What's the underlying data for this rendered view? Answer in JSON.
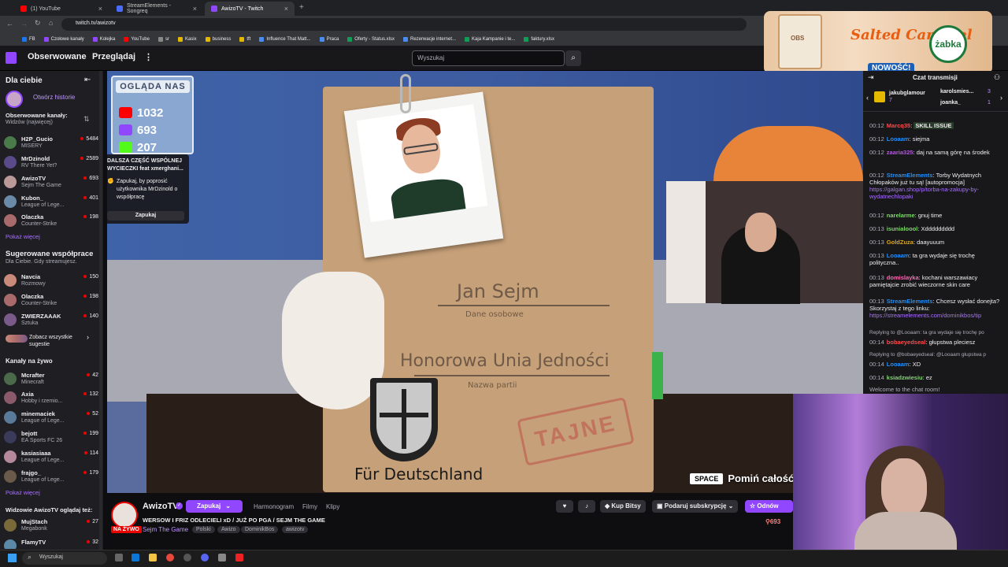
{
  "browser": {
    "tabs": [
      {
        "label": "(1) YouTube",
        "color": "#ff0000"
      },
      {
        "label": "StreamElements - Songreq",
        "color": "#4b6bfb"
      },
      {
        "label": "AwizoTV - Twitch",
        "color": "#9147ff"
      }
    ],
    "url": "twitch.tv/awizotv",
    "bookmarks": [
      "FB",
      "Czołowe kanały",
      "Kolejka",
      "YouTube",
      "sr",
      "Kasix",
      "business",
      "tft",
      "Influence That Matt...",
      "Praca",
      "Oferty - Status.xlsx",
      "Rezerwacje internet...",
      "Kaja Kampanie i te...",
      "faktury.xlsx"
    ]
  },
  "topnav": {
    "following": "Obserwowane",
    "browse": "Przeglądaj",
    "search_placeholder": "Wyszukaj",
    "more_icon": "⋮"
  },
  "ad": {
    "product": "Salted Caramel",
    "brand": "żabka",
    "badge": "NOWOŚĆ!",
    "pack_label": "OBS"
  },
  "sidebar": {
    "for_you": "Dla ciebie",
    "open_stories": "Otwórz historie",
    "followed_header": "Obserwowane kanały:",
    "followed_sort": "Widzów (najwięcej)",
    "followed": [
      {
        "name": "H2P_Gucio",
        "game": "MISERY",
        "viewers": "5484",
        "color": "#4a7a4a"
      },
      {
        "name": "MrDzinold",
        "game": "RV There Yet?",
        "viewers": "2589",
        "color": "#5a4a8a"
      },
      {
        "name": "AwizoTV",
        "game": "Sejm The Game",
        "viewers": "693",
        "color": "#b99"
      },
      {
        "name": "Kubon_",
        "game": "League of Lege...",
        "viewers": "401",
        "color": "#6a8aa8"
      },
      {
        "name": "Olaczka",
        "game": "Counter-Strike",
        "viewers": "198",
        "color": "#a86a6a"
      }
    ],
    "show_more": "Pokaż więcej",
    "collab_header": "Sugerowane współprace",
    "collab_sub": "Dla Ciebie. Gdy streamujesz.",
    "collab": [
      {
        "name": "Navcia",
        "game": "Rozmowy",
        "viewers": "150",
        "color": "#c98a7a"
      },
      {
        "name": "Olaczka",
        "game": "Counter-Strike",
        "viewers": "198",
        "color": "#a86a6a"
      },
      {
        "name": "ZWIERZAAAK",
        "game": "Sztuka",
        "viewers": "140",
        "color": "#7a5a8a"
      }
    ],
    "see_all": "Zobacz wszystkie sugestie",
    "live_header": "Kanały na żywo",
    "live": [
      {
        "name": "Mcrafter",
        "game": "Minecraft",
        "viewers": "42",
        "color": "#4a6a4a"
      },
      {
        "name": "Axia",
        "game": "Hobby i rzemio...",
        "viewers": "132",
        "color": "#8a5a6a"
      },
      {
        "name": "minemaciek",
        "game": "League of Lege...",
        "viewers": "52",
        "color": "#5a7a9a"
      },
      {
        "name": "bejott",
        "game": "EA Sports FC 26",
        "viewers": "199",
        "color": "#3a3a5a"
      },
      {
        "name": "kasiasiaaa",
        "game": "League of Lege...",
        "viewers": "114",
        "color": "#b48a9a"
      },
      {
        "name": "frajgo_",
        "game": "League of Lege...",
        "viewers": "179",
        "color": "#6a5a4a"
      }
    ],
    "show_more2": "Pokaż więcej",
    "watching_header": "Widzowie AwizoTV oglądaj też:",
    "watching": [
      {
        "name": "MujStach",
        "game": "Megabonk",
        "viewers": "27",
        "color": "#7a6a3a"
      },
      {
        "name": "FlamyTV",
        "game": "",
        "viewers": "32",
        "color": "#5a8aa8"
      }
    ]
  },
  "overlay": {
    "views_title": "OGLĄDA NAS",
    "youtube_count": "1032",
    "twitch_count": "693",
    "kick_count": "207",
    "prediction_text": "DALSZA CZĘŚĆ WSPÓLNEJ WYCIECZKI feat xmerghani...",
    "prediction_note": "Zapukaj, by poprosić użytkownika MrDzinold o współpracę",
    "prediction_button": "Zapukaj",
    "skip_key": "SPACE",
    "skip_label": "Pomiń całość"
  },
  "game": {
    "name": "Jan Sejm",
    "name_label": "Dane osobowe",
    "party": "Honorowa Unia Jedności",
    "party_label": "Nazwa partii",
    "slogan": "Für Deutschland",
    "stamp": "TAJNE"
  },
  "channel": {
    "name": "AwizoTV",
    "knock": "Zapukaj",
    "links": [
      "Harmonogram",
      "Filmy",
      "Klipy"
    ],
    "title": "WERSOW I FRIZ ODLECIELI xD / JUŻ PO PGA / SEJM THE GAME",
    "live": "NA ŻYWO",
    "game": "Sejm The Game",
    "tags": [
      "Polski",
      "Awizo",
      "DominikBos",
      "awizotv"
    ],
    "bits": "Kup Bitsy",
    "gift": "Podaruj subskrypcję",
    "renew": "Odnów",
    "viewers": "693"
  },
  "chat": {
    "header": "Czat transmisji",
    "top": [
      {
        "name": "jakubglamour",
        "amount": "7"
      },
      {
        "name": "karolsmies...",
        "amount": "3"
      },
      {
        "name": "joanka_",
        "amount": "1"
      }
    ],
    "messages": [
      {
        "time": "00:12",
        "user": "Marcq35",
        "color": "#ff4a4a",
        "text": "SKILL ISSUE"
      },
      {
        "time": "00:12",
        "user": "Looaam",
        "color": "#1e90ff",
        "text": "siejma"
      },
      {
        "time": "00:12",
        "user": "zaaria325",
        "color": "#b05cd6",
        "text": "daj na samą górę na środek"
      },
      {
        "time": "00:12",
        "user": "StreamElements",
        "color": "#1e90ff",
        "text": "Torby Wydatnych Chłopaków już tu są! [autopromocja] ",
        "link": "https://galgan.shop/p/torba-na-zakupy-by-wydatnechlopaki"
      },
      {
        "time": "00:12",
        "user": "narelarme",
        "color": "#7dd66b",
        "text": "gnuj time"
      },
      {
        "time": "00:13",
        "user": "isunialoool",
        "color": "#7dd66b",
        "text": "Xddddddddd"
      },
      {
        "time": "00:13",
        "user": "GoldZuza",
        "color": "#daa520",
        "text": "daayuuum"
      },
      {
        "time": "00:13",
        "user": "Looaam",
        "color": "#1e90ff",
        "text": "ta gra wydaje się trochę polityczna.."
      },
      {
        "time": "00:13",
        "user": "domislayka",
        "color": "#ff69b4",
        "text": "kochani warszawiacy pamiętajcie zrobić wieczorne skin care"
      },
      {
        "time": "00:13",
        "user": "StreamElements",
        "color": "#1e90ff",
        "text": "Chcesz wysłać donejta? Skorzystaj z tego linku: ",
        "link": "https://streamelements.com/dominikbos/tip"
      },
      {
        "time": "00:14",
        "user": "bobaeyedseal",
        "color": "#ff4a4a",
        "text": "głupstwa pleciesz",
        "reply": "Replying to @Looaam: ta gra wydaje się trochę po"
      },
      {
        "time": "00:14",
        "user": "Looaam",
        "color": "#1e90ff",
        "text": "XD",
        "reply": "Replying to @bobaeyedseal: @Looaam głupstwa p"
      },
      {
        "time": "00:14",
        "user": "ksiadzwiesiu",
        "color": "#7dd66b",
        "text": "ez"
      }
    ],
    "welcome": "Welcome to the chat room!"
  },
  "taskbar": {
    "search": "Wyszukaj"
  }
}
